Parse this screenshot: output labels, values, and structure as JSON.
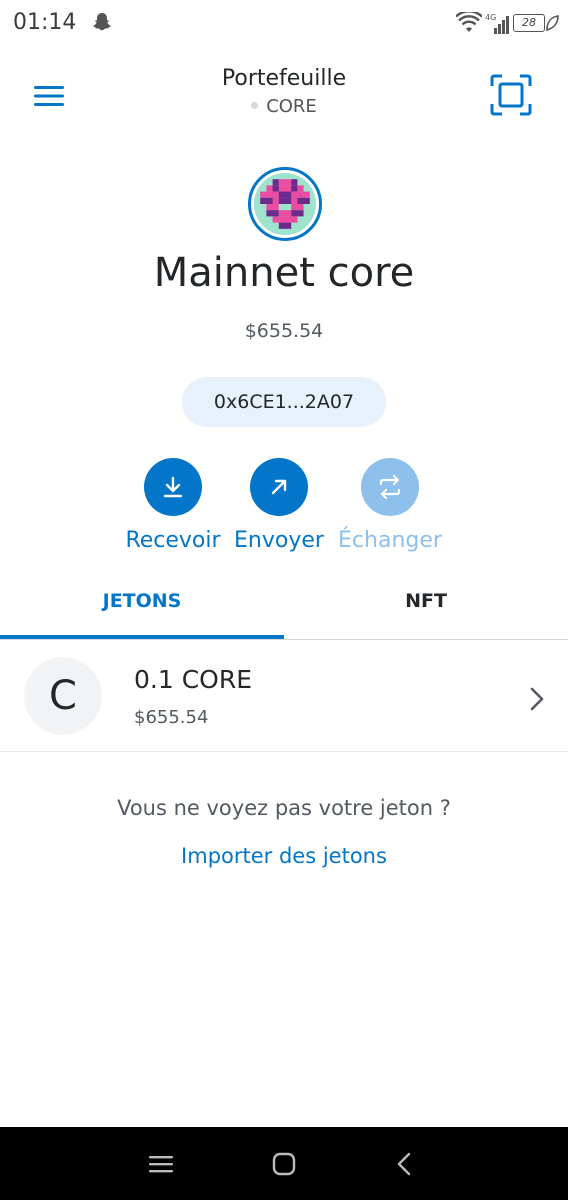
{
  "status_bar": {
    "time": "01:14",
    "network_label": "4G",
    "battery": "28",
    "icons": [
      "snapchat-icon",
      "wifi-icon",
      "signal-icon",
      "battery-icon",
      "leaf-icon"
    ]
  },
  "header": {
    "title": "Portefeuille",
    "network": "CORE",
    "menu_icon": "hamburger-menu-icon",
    "scan_icon": "qr-scan-icon"
  },
  "account": {
    "name": "Mainnet core",
    "balance": "$655.54",
    "address": "0x6CE1...2A07"
  },
  "actions": [
    {
      "label": "Recevoir",
      "icon": "download-icon",
      "enabled": true
    },
    {
      "label": "Envoyer",
      "icon": "arrow-up-right-icon",
      "enabled": true
    },
    {
      "label": "Échanger",
      "icon": "swap-icon",
      "enabled": false
    }
  ],
  "tabs": [
    {
      "label": "JETONS",
      "active": true
    },
    {
      "label": "NFT",
      "active": false
    }
  ],
  "tokens": [
    {
      "icon_letter": "C",
      "amount": "0.1 CORE",
      "fiat": "$655.54"
    }
  ],
  "import": {
    "question": "Vous ne voyez pas votre jeton ?",
    "link": "Importer des jetons"
  },
  "colors": {
    "accent": "#0376c9",
    "accent_disabled": "#8ec0ec",
    "address_bg": "#e7f1fb",
    "text": "#24272a"
  }
}
